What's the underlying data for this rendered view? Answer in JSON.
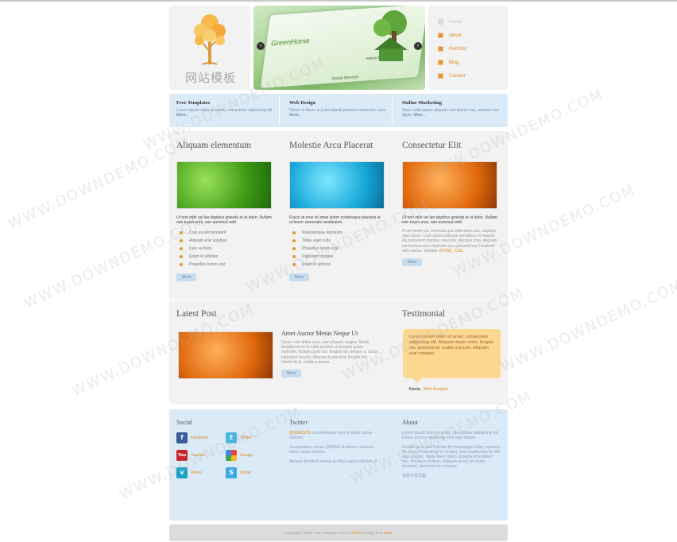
{
  "header": {
    "logo_text": "网站模板",
    "slider_texts": [
      "GreenHome",
      "Interactive Media",
      "Social Services"
    ]
  },
  "nav": [
    {
      "label": "Home",
      "active": false
    },
    {
      "label": "About",
      "active": true
    },
    {
      "label": "Portfolio",
      "active": true
    },
    {
      "label": "Blog",
      "active": true
    },
    {
      "label": "Contact",
      "active": true
    }
  ],
  "features": [
    {
      "title": "Free Templates",
      "text": "Lorem ipsum dolor sit amet, consectetur adipiscing elit.",
      "more": "More..."
    },
    {
      "title": "Web Design",
      "text": "Donec in libero in justo blandit posuere morbi nec urna.",
      "more": "More..."
    },
    {
      "title": "Online Marketing",
      "text": "Nunc nulla quam, aliquam sed dictum nec, semper sed ligula.",
      "more": "More..."
    }
  ],
  "columns": [
    {
      "title": "Aliquam elementum",
      "intro": "Ut non nibh vel leo dapibus gravida et at dolor. Nullam non turpis eros, non euismod velit.",
      "list": [
        "Cras eu elit hendrerit",
        "Aliquam erat volutpat",
        "Duis vel felis",
        "Etiam id ultricies",
        "Phasellus lorem erat"
      ],
      "more": "More"
    },
    {
      "title": "Molestie Arcu Placerat",
      "intro": "Fusce at eros sit amet lorem scelerisque placerat ut ut lorem venenatis vestibulum.",
      "list": [
        "Pellentesque dignissim",
        "Tellus eget nulla",
        "Phasellus lorem erat",
        "Dignissim congue",
        "Etiam id ultricies"
      ],
      "more": "More"
    },
    {
      "title": "Consectetur Elit",
      "intro": "Ut non nibh vel leo dapibus gravida et at dolor. Nullam non turpis eros, non euismod velit.",
      "para": "Proin lorem est, vehicula quis bibendum nec, dapibus eget purus. Cum sociis natoque penatibus et magnis dis parturient montes, nascetur ridiculus mus. Aliquam elementum arcu molestie arcu placerat nec hendrerit odio varius. Validate",
      "links": [
        "XHTML",
        "CSS"
      ],
      "more": "More"
    }
  ],
  "latest_post": {
    "heading": "Latest Post",
    "title": "Amet Auctor Metus Neque Ut",
    "text": "Donec non tellus urna, sed aliquam magna. Morbi fringilla lorem et nulla porttitor at semper quam molestie. Nullam justo nisl, feugiat nec tempor a, luctus imperdiet mauris. Aliquam turpis erat, feugiat nec hendrerit et, mattis a ipsum.",
    "more": "More"
  },
  "testimonial": {
    "heading": "Testimonial",
    "quote": "Lorem ipsum dolor sit amet, consectetur adipiscing elit. Aliquam turpis enim, feugiat nec euismod et, mattis a ipsum. Aliquam erat volutpat.",
    "author": "Kenia",
    "role": "Web Designer"
  },
  "footer": {
    "social_title": "Social",
    "social": [
      "Facebook",
      "Twitter",
      "Youtube",
      "Google",
      "Vimeo",
      "Skype"
    ],
    "twitter_title": "Twitter",
    "tweets": [
      {
        "handle": "@WEBSITE",
        "text": "at scelerisque urna in tellus varius ultricies."
      },
      {
        "handle": "",
        "text": "Suspendisse ornare @FREE tincidunt massa in tellus varius ultricies."
      },
      {
        "handle": "",
        "text": "Aenean tincidunt massa in tellus varius ultricies. #"
      }
    ],
    "about_title": "About",
    "about": [
      "Lorem ipsum dolor sit amet, consectetur adipiscing elit. Donec cursus adipiscing eros eget aliquet.",
      "Credits go to devTuts/dev for homepage slider, myIcons for icons, Photoshop for photos, and IconArchive for the logo graphic. Nulla libero libero, gravida et tincidunt nec, tincidunt et libero. Aliquam at est vel quam tincidunt, tincidunt non ut turpis.",
      "免费分享页面"
    ]
  },
  "copyright": {
    "text": "Copyright © 2012 Your Company Name |",
    "link1": "XHTML",
    "mid": "Design from",
    "link2": "Index"
  },
  "watermark": "WWW.DOWNDEMO.COM"
}
